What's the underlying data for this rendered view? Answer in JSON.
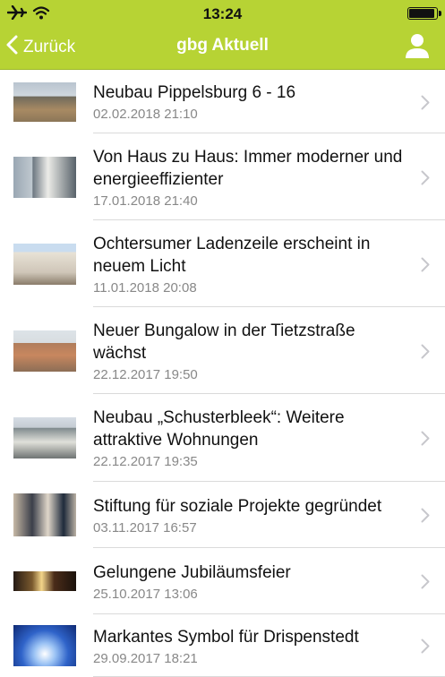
{
  "status": {
    "time": "13:24",
    "battery_level": 0.95
  },
  "nav": {
    "back_label": "Zurück",
    "title": "gbg Aktuell"
  },
  "colors": {
    "header": "#b7d334",
    "text": "#111111",
    "date": "#888888",
    "chevron": "#c7c7cc"
  },
  "news": [
    {
      "title": "Neubau Pippelsburg 6 - 16",
      "date": "02.02.2018 21:10"
    },
    {
      "title": "Von Haus zu Haus: Immer moderner und energieeffizienter",
      "date": "17.01.2018 21:40"
    },
    {
      "title": "Ochtersumer Ladenzeile erscheint in neuem Licht",
      "date": "11.01.2018 20:08"
    },
    {
      "title": "Neuer Bungalow in der Tietzstraße wächst",
      "date": "22.12.2017 19:50"
    },
    {
      "title": "Neubau „Schusterbleek“: Weitere attraktive Wohnungen",
      "date": "22.12.2017 19:35"
    },
    {
      "title": "Stiftung für soziale Projekte gegründet",
      "date": "03.11.2017 16:57"
    },
    {
      "title": "Gelungene Jubiläumsfeier",
      "date": "25.10.2017 13:06"
    },
    {
      "title": "Markantes Symbol für Drispenstedt",
      "date": "29.09.2017 18:21"
    }
  ]
}
